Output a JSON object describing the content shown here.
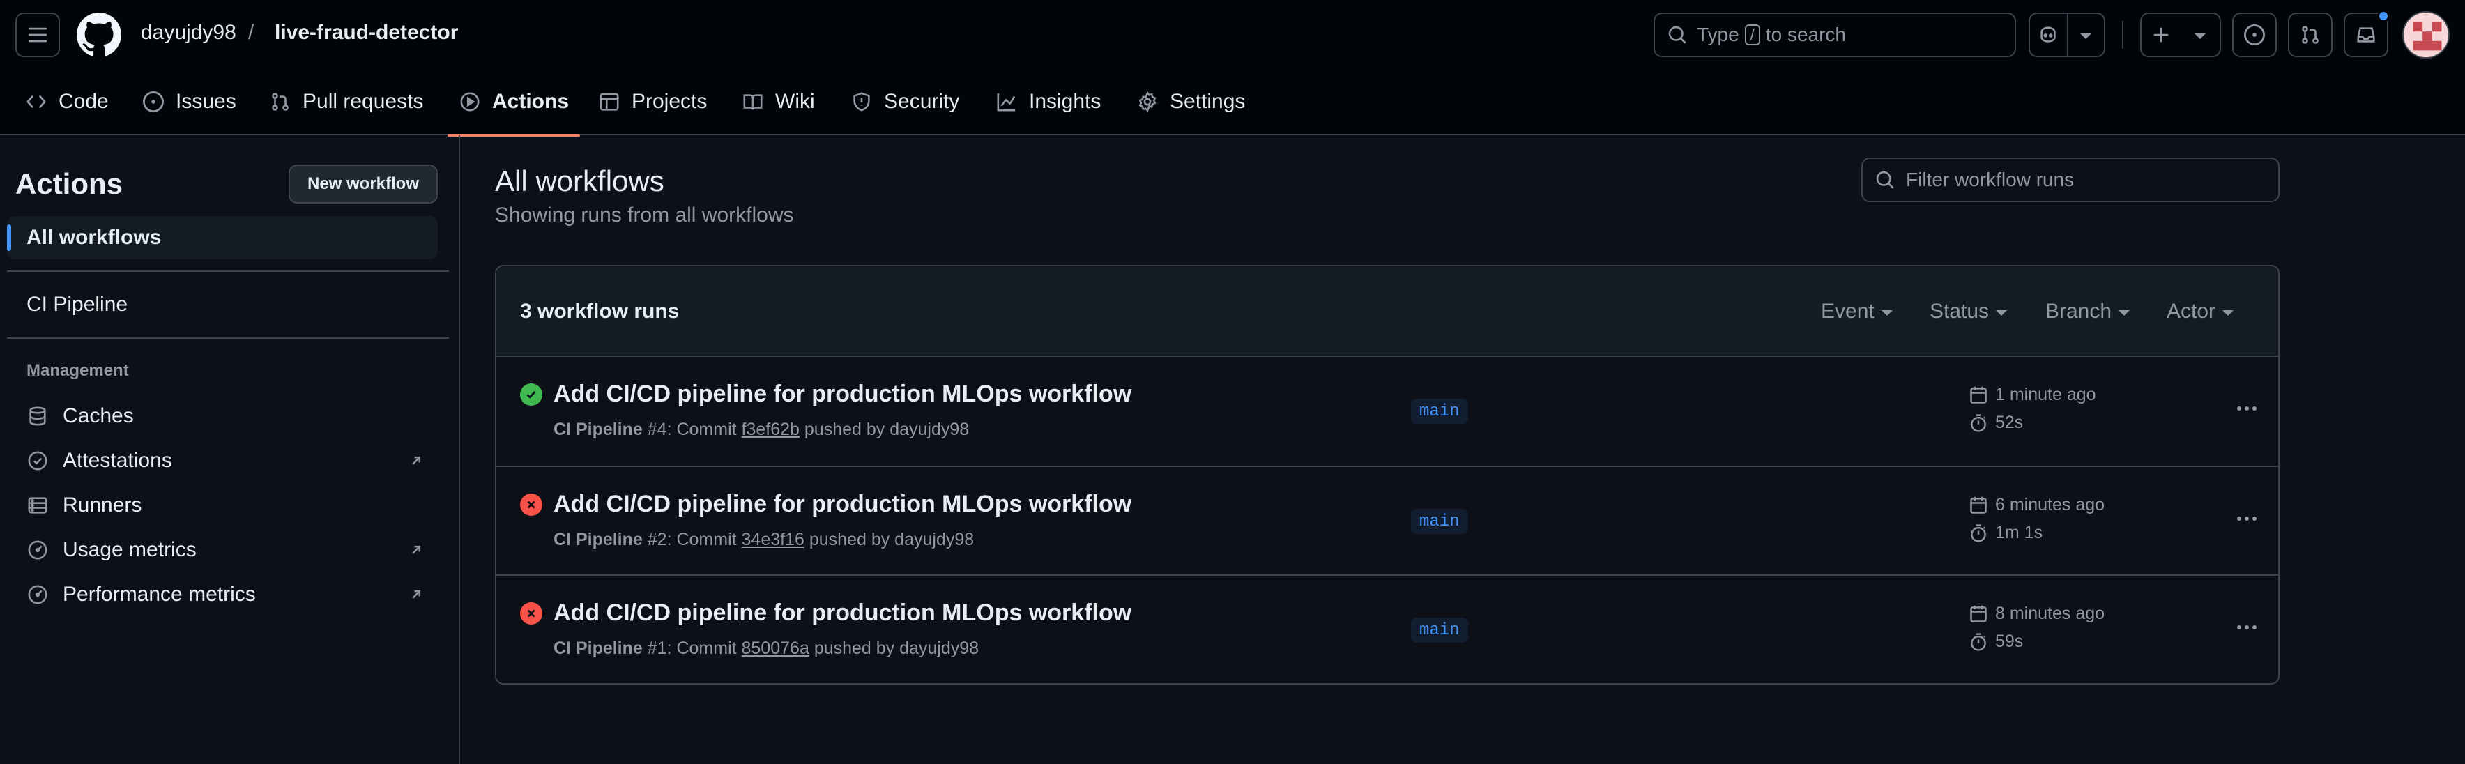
{
  "header": {
    "owner": "dayujdy98",
    "separator": "/",
    "repo": "live-fraud-detector",
    "search_prefix": "Type",
    "search_key": "/",
    "search_suffix": "to search"
  },
  "repo_nav": {
    "tabs": [
      {
        "label": "Code",
        "icon": "code-icon"
      },
      {
        "label": "Issues",
        "icon": "issue-icon"
      },
      {
        "label": "Pull requests",
        "icon": "pull-request-icon"
      },
      {
        "label": "Actions",
        "icon": "play-icon",
        "active": true
      },
      {
        "label": "Projects",
        "icon": "table-icon"
      },
      {
        "label": "Wiki",
        "icon": "book-icon"
      },
      {
        "label": "Security",
        "icon": "shield-icon"
      },
      {
        "label": "Insights",
        "icon": "graph-icon"
      },
      {
        "label": "Settings",
        "icon": "gear-icon"
      }
    ]
  },
  "sidebar": {
    "title": "Actions",
    "new_workflow": "New workflow",
    "all_workflows": "All workflows",
    "workflows": [
      "CI Pipeline"
    ],
    "management_heading": "Management",
    "management": [
      {
        "label": "Caches",
        "icon": "database-icon",
        "external": false
      },
      {
        "label": "Attestations",
        "icon": "verified-icon",
        "external": true
      },
      {
        "label": "Runners",
        "icon": "server-icon",
        "external": false
      },
      {
        "label": "Usage metrics",
        "icon": "meter-icon",
        "external": true
      },
      {
        "label": "Performance metrics",
        "icon": "meter-icon",
        "external": true
      }
    ]
  },
  "main": {
    "title": "All workflows",
    "subtitle": "Showing runs from all workflows",
    "filter_placeholder": "Filter workflow runs",
    "runs_count": "3 workflow runs",
    "filters": [
      "Event",
      "Status",
      "Branch",
      "Actor"
    ],
    "runs": [
      {
        "status": "success",
        "title": "Add CI/CD pipeline for production MLOps workflow",
        "workflow": "CI Pipeline",
        "run_number": "#4",
        "commit_prefix": ": Commit",
        "sha": "f3ef62b",
        "pushed_by": "pushed by dayujdy98",
        "branch": "main",
        "when": "1 minute ago",
        "duration": "52s"
      },
      {
        "status": "failure",
        "title": "Add CI/CD pipeline for production MLOps workflow",
        "workflow": "CI Pipeline",
        "run_number": "#2",
        "commit_prefix": ": Commit",
        "sha": "34e3f16",
        "pushed_by": "pushed by dayujdy98",
        "branch": "main",
        "when": "6 minutes ago",
        "duration": "1m 1s"
      },
      {
        "status": "failure",
        "title": "Add CI/CD pipeline for production MLOps workflow",
        "workflow": "CI Pipeline",
        "run_number": "#1",
        "commit_prefix": ": Commit",
        "sha": "850076a",
        "pushed_by": "pushed by dayujdy98",
        "branch": "main",
        "when": "8 minutes ago",
        "duration": "59s"
      }
    ]
  },
  "colors": {
    "background": "#0d1117",
    "header_bg": "#010409",
    "border": "#3d444d",
    "accent_tab": "#f78166",
    "success": "#3fb950",
    "failure": "#f85149",
    "link_blue": "#4493f8"
  }
}
